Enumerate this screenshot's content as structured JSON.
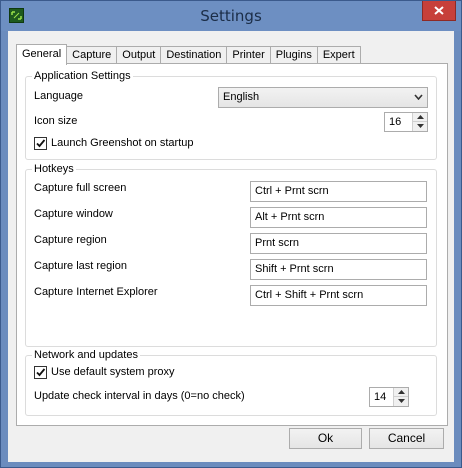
{
  "window": {
    "title": "Settings"
  },
  "tabs": [
    {
      "label": "General",
      "active": true
    },
    {
      "label": "Capture"
    },
    {
      "label": "Output"
    },
    {
      "label": "Destination"
    },
    {
      "label": "Printer"
    },
    {
      "label": "Plugins"
    },
    {
      "label": "Expert"
    }
  ],
  "application_settings": {
    "group_label": "Application Settings",
    "language_label": "Language",
    "language_value": "English",
    "icon_size_label": "Icon size",
    "icon_size_value": "16",
    "launch_on_startup_label": "Launch Greenshot on startup",
    "launch_on_startup_checked": true
  },
  "hotkeys": {
    "group_label": "Hotkeys",
    "items": [
      {
        "label": "Capture full screen",
        "value": "Ctrl + Prnt scrn"
      },
      {
        "label": "Capture window",
        "value": "Alt + Prnt scrn"
      },
      {
        "label": "Capture region",
        "value": "Prnt scrn"
      },
      {
        "label": "Capture last region",
        "value": "Shift + Prnt scrn"
      },
      {
        "label": "Capture Internet Explorer",
        "value": "Ctrl + Shift + Prnt scrn"
      }
    ]
  },
  "network": {
    "group_label": "Network and updates",
    "proxy_label": "Use default system proxy",
    "proxy_checked": true,
    "interval_label": "Update check interval in days (0=no check)",
    "interval_value": "14"
  },
  "buttons": {
    "ok": "Ok",
    "cancel": "Cancel"
  },
  "icons": {
    "app": "greenshot-app-icon",
    "close": "close-icon",
    "dropdown": "chevron-down-icon",
    "spin_up": "spin-up-icon",
    "spin_down": "spin-down-icon",
    "checkmark": "checkmark-icon"
  },
  "colors": {
    "titlebar": "#6d8fc2",
    "close_button": "#c7403a",
    "dialog_bg": "#f0f0f0"
  }
}
